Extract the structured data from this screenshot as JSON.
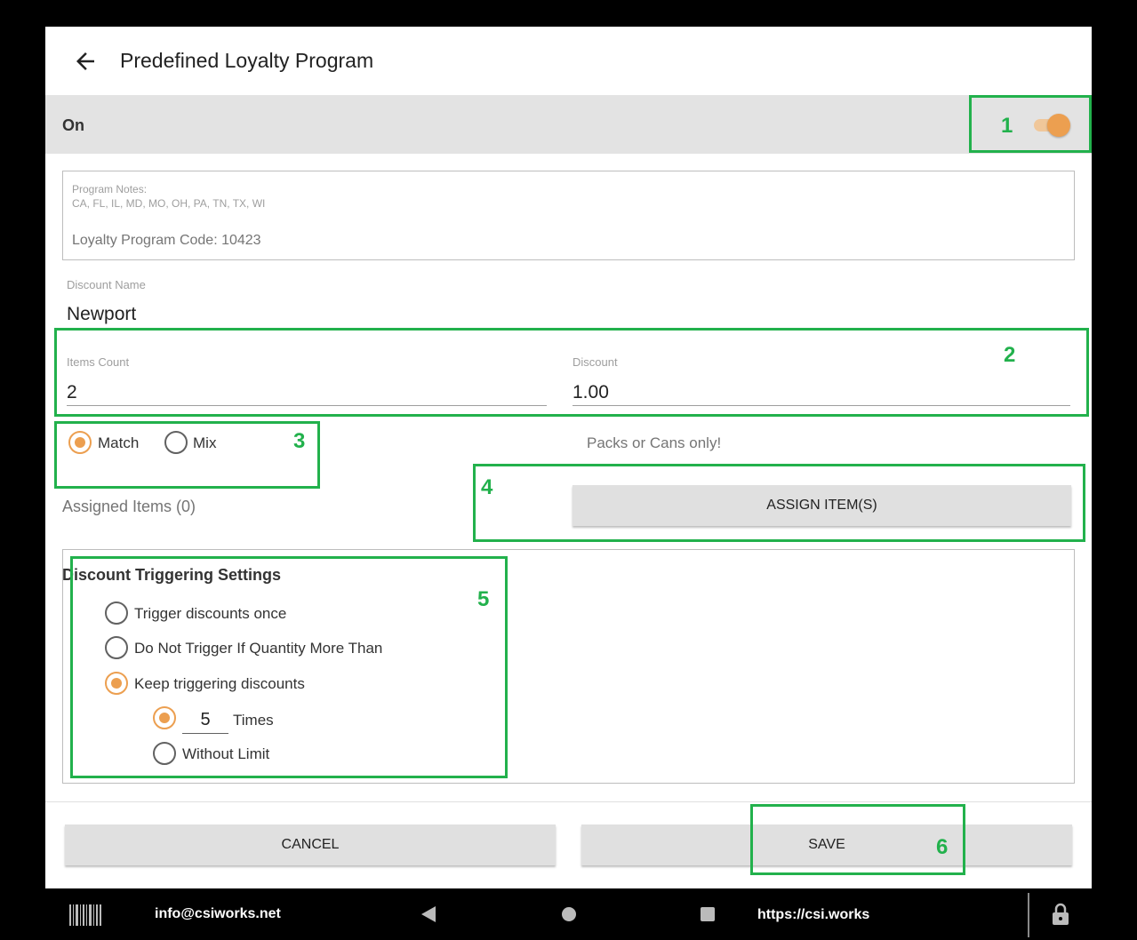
{
  "header": {
    "title": "Predefined Loyalty Program"
  },
  "status": {
    "label": "On",
    "enabled": true
  },
  "notes": {
    "label": "Program Notes:",
    "states": "CA, FL, IL, MD, MO, OH, PA, TN, TX, WI",
    "code": "Loyalty Program Code: 10423"
  },
  "discount_name": {
    "label": "Discount Name",
    "value": "Newport"
  },
  "items_count": {
    "label": "Items Count",
    "value": "2"
  },
  "discount": {
    "label": "Discount",
    "value": "1.00"
  },
  "mode": {
    "options": [
      {
        "label": "Match",
        "checked": true
      },
      {
        "label": "Mix",
        "checked": false
      }
    ],
    "hint": "Packs or Cans only!"
  },
  "assigned": {
    "label": "Assigned Items (0)",
    "button": "ASSIGN ITEM(S)"
  },
  "trigger": {
    "title": "Discount Triggering Settings",
    "options": [
      {
        "label": "Trigger discounts once",
        "checked": false
      },
      {
        "label": "Do Not Trigger If Quantity More Than",
        "checked": false
      },
      {
        "label": "Keep triggering discounts",
        "checked": true
      }
    ],
    "sub_options": [
      {
        "label": "Times",
        "value": "5",
        "checked": true
      },
      {
        "label": "Without Limit",
        "checked": false
      }
    ]
  },
  "actions": {
    "cancel": "CANCEL",
    "save": "SAVE"
  },
  "annotations": [
    "1",
    "2",
    "3",
    "4",
    "5",
    "6"
  ],
  "navbar": {
    "email": "info@csiworks.net",
    "url": "https://csi.works"
  },
  "colors": {
    "accent": "#ec9f50",
    "annotation": "#22b14c",
    "bar": "#e3e3e3"
  }
}
